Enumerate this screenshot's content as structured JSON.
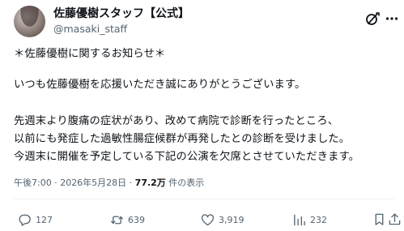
{
  "author": {
    "display_name": "佐藤優樹スタッフ【公式】",
    "handle": "@masaki_staff"
  },
  "post": {
    "lines": [
      "＊佐藤優樹に関するお知らせ＊",
      "いつも佐藤優樹を応援いただき誠にありがとうございます。",
      "先週末より腹痛の症状があり、改めて病院で診断を行ったところ、",
      "以前にも発症した過敏性腸症候群が再発したとの診断を受けました。",
      "今週末に開催を予定している下記の公演を欠席とさせていただきます。"
    ]
  },
  "meta": {
    "timestamp": "午後7:00 · 2026年5月28日 · ",
    "views_count": "77.2万",
    "views_label": " 件の表示"
  },
  "actions": {
    "replies": "127",
    "reposts": "639",
    "likes": "3,919",
    "views": "232"
  },
  "icons": {
    "grok": "grok-icon",
    "more": "more-icon",
    "reply": "reply-icon",
    "repost": "repost-icon",
    "like": "heart-icon",
    "views": "views-icon",
    "bookmark": "bookmark-icon",
    "share": "share-icon"
  },
  "colors": {
    "text": "#0f1419",
    "secondary": "#536471",
    "divider": "#eff3f4",
    "background": "#ffffff"
  }
}
